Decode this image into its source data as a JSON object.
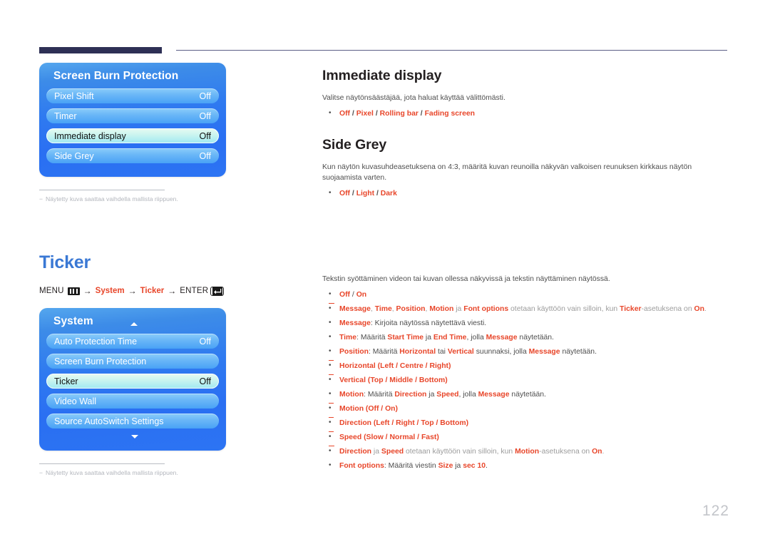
{
  "page": {
    "number": "122",
    "footnote": "Näytetty kuva saattaa vaihdella mallista riippuen.",
    "footnote_dash": "−"
  },
  "osd_panels": [
    {
      "title": "Screen Burn Protection",
      "has_scroll_up": false,
      "has_scroll_down": false,
      "rows": [
        {
          "label": "Pixel Shift",
          "value": "Off",
          "selected": false
        },
        {
          "label": "Timer",
          "value": "Off",
          "selected": false
        },
        {
          "label": "Immediate display",
          "value": "Off",
          "selected": true
        },
        {
          "label": "Side Grey",
          "value": "Off",
          "selected": false
        }
      ]
    },
    {
      "title": "System",
      "has_scroll_up": true,
      "has_scroll_down": true,
      "rows": [
        {
          "label": "Auto Protection Time",
          "value": "Off",
          "selected": false
        },
        {
          "label": "Screen Burn Protection",
          "value": "",
          "selected": false
        },
        {
          "label": "Ticker",
          "value": "Off",
          "selected": true
        },
        {
          "label": "Video Wall",
          "value": "",
          "selected": false
        },
        {
          "label": "Source AutoSwitch Settings",
          "value": "",
          "selected": false
        }
      ]
    }
  ],
  "ticker_section": {
    "heading": "Ticker",
    "menu_path": {
      "menu_label": "MENU",
      "menu_icon": "menu-bars-icon",
      "arrow": "→",
      "step1": "System",
      "step2": "Ticker",
      "enter_label": "ENTER",
      "enter_icon": "enter-key-icon"
    }
  },
  "right_column": {
    "immediate_display": {
      "heading": "Immediate display",
      "body": "Valitse näytönsäästäjää, jota haluat käyttää välittömästi.",
      "options": [
        "Off",
        "Pixel",
        "Rolling bar",
        "Fading screen"
      ]
    },
    "side_grey": {
      "heading": "Side Grey",
      "body": "Kun näytön kuvasuhdeasetuksena on 4:3, määritä kuvan reunoilla näkyvän valkoisen reunuksen kirkkaus näytön suojaamista varten.",
      "options": [
        "Off",
        "Light",
        "Dark"
      ]
    },
    "ticker": {
      "body": "Tekstin syöttäminen videon tai kuvan ollessa näkyvissä ja tekstin näyttäminen näytössä.",
      "items": [
        {
          "kind": "bullet",
          "parts": [
            {
              "t": "Off",
              "s": "r"
            },
            {
              "t": " / ",
              "s": "k"
            },
            {
              "t": "On",
              "s": "r"
            }
          ]
        },
        {
          "kind": "note",
          "parts": [
            {
              "t": "Message",
              "s": "r"
            },
            {
              "t": ", ",
              "s": "g"
            },
            {
              "t": "Time",
              "s": "r"
            },
            {
              "t": ", ",
              "s": "g"
            },
            {
              "t": "Position",
              "s": "r"
            },
            {
              "t": ", ",
              "s": "g"
            },
            {
              "t": "Motion",
              "s": "r"
            },
            {
              "t": " ja ",
              "s": "g"
            },
            {
              "t": "Font options",
              "s": "r"
            },
            {
              "t": " otetaan käyttöön vain silloin, kun ",
              "s": "g"
            },
            {
              "t": "Ticker",
              "s": "r"
            },
            {
              "t": "-asetuksena on ",
              "s": "g"
            },
            {
              "t": "On",
              "s": "r"
            },
            {
              "t": ".",
              "s": "g"
            }
          ]
        },
        {
          "kind": "bullet",
          "parts": [
            {
              "t": "Message",
              "s": "r"
            },
            {
              "t": ": Kirjoita näytössä näytettävä viesti.",
              "s": "k"
            }
          ]
        },
        {
          "kind": "bullet",
          "parts": [
            {
              "t": "Time",
              "s": "r"
            },
            {
              "t": ": Määritä ",
              "s": "k"
            },
            {
              "t": "Start Time",
              "s": "r"
            },
            {
              "t": " ja ",
              "s": "k"
            },
            {
              "t": "End Time",
              "s": "r"
            },
            {
              "t": ", jolla ",
              "s": "k"
            },
            {
              "t": "Message",
              "s": "r"
            },
            {
              "t": " näytetään.",
              "s": "k"
            }
          ]
        },
        {
          "kind": "bullet",
          "parts": [
            {
              "t": "Position",
              "s": "r"
            },
            {
              "t": ": Määritä ",
              "s": "k"
            },
            {
              "t": "Horizontal",
              "s": "r"
            },
            {
              "t": " tai ",
              "s": "k"
            },
            {
              "t": "Vertical",
              "s": "r"
            },
            {
              "t": " suunnaksi, jolla ",
              "s": "k"
            },
            {
              "t": "Message",
              "s": "r"
            },
            {
              "t": " näytetään.",
              "s": "k"
            }
          ]
        },
        {
          "kind": "sub",
          "parts": [
            {
              "t": "Horizontal",
              "s": "r"
            },
            {
              "t": " (",
              "s": "r"
            },
            {
              "t": "Left",
              "s": "r"
            },
            {
              "t": " / ",
              "s": "r"
            },
            {
              "t": "Centre",
              "s": "r"
            },
            {
              "t": " / ",
              "s": "r"
            },
            {
              "t": "Right",
              "s": "r"
            },
            {
              "t": ")",
              "s": "r"
            }
          ]
        },
        {
          "kind": "sub",
          "parts": [
            {
              "t": "Vertical",
              "s": "r"
            },
            {
              "t": " (",
              "s": "r"
            },
            {
              "t": "Top",
              "s": "r"
            },
            {
              "t": " / ",
              "s": "r"
            },
            {
              "t": "Middle",
              "s": "r"
            },
            {
              "t": " / ",
              "s": "r"
            },
            {
              "t": "Bottom",
              "s": "r"
            },
            {
              "t": ")",
              "s": "r"
            }
          ]
        },
        {
          "kind": "bullet",
          "parts": [
            {
              "t": "Motion",
              "s": "r"
            },
            {
              "t": ": Määritä ",
              "s": "k"
            },
            {
              "t": "Direction",
              "s": "r"
            },
            {
              "t": " ja ",
              "s": "k"
            },
            {
              "t": "Speed",
              "s": "r"
            },
            {
              "t": ", jolla ",
              "s": "k"
            },
            {
              "t": "Message",
              "s": "r"
            },
            {
              "t": " näytetään.",
              "s": "k"
            }
          ]
        },
        {
          "kind": "sub",
          "parts": [
            {
              "t": "Motion",
              "s": "r"
            },
            {
              "t": " (",
              "s": "r"
            },
            {
              "t": "Off",
              "s": "r"
            },
            {
              "t": " / ",
              "s": "r"
            },
            {
              "t": "On",
              "s": "r"
            },
            {
              "t": ")",
              "s": "r"
            }
          ]
        },
        {
          "kind": "sub",
          "parts": [
            {
              "t": "Direction",
              "s": "r"
            },
            {
              "t": " (",
              "s": "r"
            },
            {
              "t": "Left",
              "s": "r"
            },
            {
              "t": " / ",
              "s": "r"
            },
            {
              "t": "Right",
              "s": "r"
            },
            {
              "t": " / ",
              "s": "r"
            },
            {
              "t": "Top",
              "s": "r"
            },
            {
              "t": " / ",
              "s": "r"
            },
            {
              "t": "Bottom",
              "s": "r"
            },
            {
              "t": ")",
              "s": "r"
            }
          ]
        },
        {
          "kind": "sub",
          "parts": [
            {
              "t": "Speed",
              "s": "r"
            },
            {
              "t": " (",
              "s": "r"
            },
            {
              "t": "Slow",
              "s": "r"
            },
            {
              "t": " / ",
              "s": "r"
            },
            {
              "t": "Normal",
              "s": "r"
            },
            {
              "t": " / ",
              "s": "r"
            },
            {
              "t": "Fast",
              "s": "r"
            },
            {
              "t": ")",
              "s": "r"
            }
          ]
        },
        {
          "kind": "note",
          "parts": [
            {
              "t": "Direction",
              "s": "r"
            },
            {
              "t": " ja ",
              "s": "g"
            },
            {
              "t": "Speed",
              "s": "r"
            },
            {
              "t": " otetaan käyttöön vain silloin, kun ",
              "s": "g"
            },
            {
              "t": "Motion",
              "s": "r"
            },
            {
              "t": "-asetuksena on ",
              "s": "g"
            },
            {
              "t": "On",
              "s": "r"
            },
            {
              "t": ".",
              "s": "g"
            }
          ]
        },
        {
          "kind": "bullet",
          "parts": [
            {
              "t": "Font options",
              "s": "r"
            },
            {
              "t": ": Määritä viestin ",
              "s": "k"
            },
            {
              "t": "Size",
              "s": "r"
            },
            {
              "t": " ja ",
              "s": "k"
            },
            {
              "t": "sec 10",
              "s": "r"
            },
            {
              "t": ".",
              "s": "k"
            }
          ]
        }
      ]
    }
  },
  "colors": {
    "accent_red": "#e8462a",
    "heading_blue": "#3a78d4",
    "rule_navy": "#2e3055",
    "osd_blue": "#2a6ff2"
  }
}
